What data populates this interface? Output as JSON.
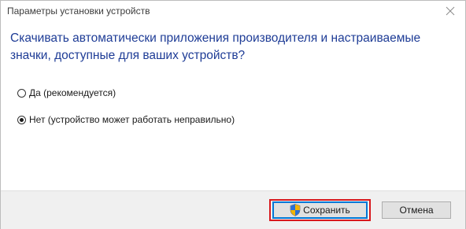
{
  "window": {
    "title": "Параметры установки устройств"
  },
  "dialog": {
    "question": "Скачивать автоматически приложения производителя и настраиваемые значки, доступные для ваших устройств?",
    "options": [
      {
        "label": "Да (рекомендуется)",
        "checked": false
      },
      {
        "label": "Нет (устройство может работать неправильно)",
        "checked": true
      }
    ]
  },
  "buttons": {
    "save_label": "Сохранить",
    "cancel_label": "Отмена"
  },
  "icons": {
    "close": "close-icon",
    "save": "uac-shield-icon"
  },
  "colors": {
    "question_text": "#1e3c96",
    "highlight": "#d8191e",
    "default_button_border": "#0078d7"
  }
}
